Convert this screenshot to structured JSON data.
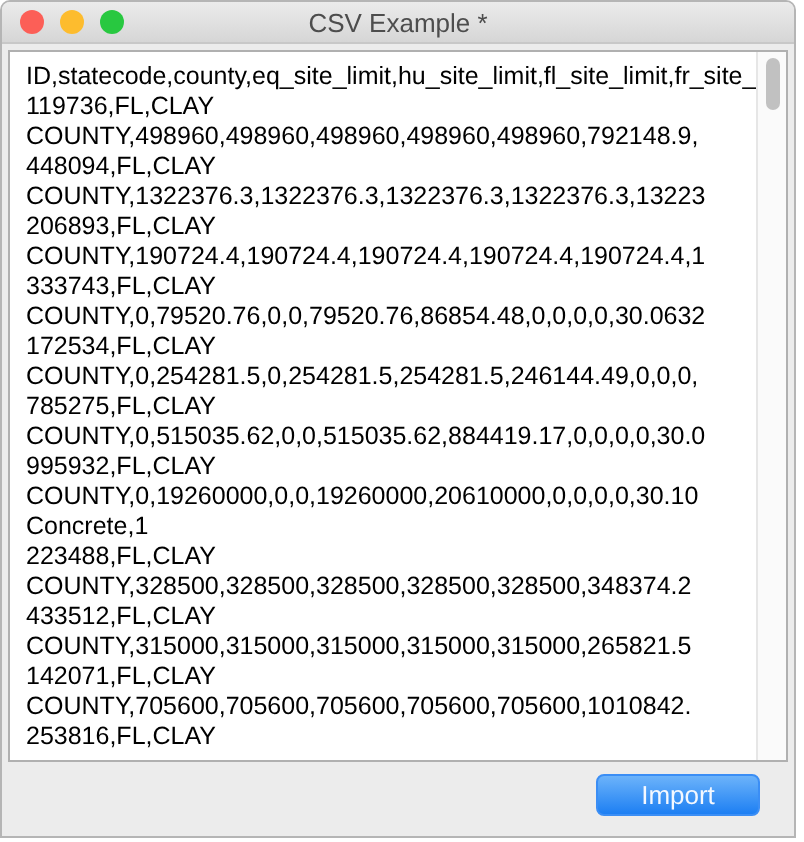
{
  "window": {
    "title": "CSV Example *"
  },
  "text_area": {
    "lines": [
      "ID,statecode,county,eq_site_limit,hu_site_limit,fl_site_limit,fr_site_",
      "119736,FL,CLAY",
      "COUNTY,498960,498960,498960,498960,498960,792148.9,",
      "448094,FL,CLAY",
      "COUNTY,1322376.3,1322376.3,1322376.3,1322376.3,13223",
      "206893,FL,CLAY",
      "COUNTY,190724.4,190724.4,190724.4,190724.4,190724.4,1",
      "333743,FL,CLAY",
      "COUNTY,0,79520.76,0,0,79520.76,86854.48,0,0,0,0,30.0632",
      "172534,FL,CLAY",
      "COUNTY,0,254281.5,0,254281.5,254281.5,246144.49,0,0,0,",
      "785275,FL,CLAY",
      "COUNTY,0,515035.62,0,0,515035.62,884419.17,0,0,0,0,30.0",
      "995932,FL,CLAY",
      "COUNTY,0,19260000,0,0,19260000,20610000,0,0,0,0,30.10",
      "Concrete,1",
      "223488,FL,CLAY",
      "COUNTY,328500,328500,328500,328500,328500,348374.2",
      "433512,FL,CLAY",
      "COUNTY,315000,315000,315000,315000,315000,265821.5",
      "142071,FL,CLAY",
      "COUNTY,705600,705600,705600,705600,705600,1010842.",
      "253816,FL,CLAY"
    ]
  },
  "buttons": [
    {
      "label": "Import",
      "kind": "default"
    }
  ]
}
